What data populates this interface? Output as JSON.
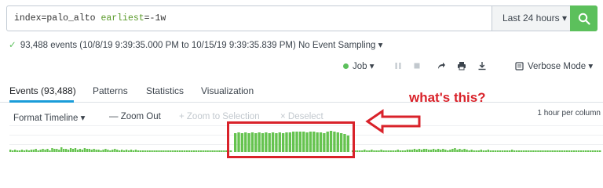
{
  "search": {
    "query_index": "index=palo_alto",
    "query_kw": "earliest",
    "query_val": "=-1w",
    "time_range": "Last 24 hours",
    "time_range_caret": "▾"
  },
  "status": {
    "check": "✓",
    "summary": "93,488 events (10/8/19 9:39:35.000 PM to 10/15/19 9:39:35.839 PM)",
    "sampling": "No Event Sampling ▾"
  },
  "toolbar": {
    "job": "Job ▾",
    "mode": "Verbose Mode ▾"
  },
  "tabs": [
    {
      "label": "Events (93,488)"
    },
    {
      "label": "Patterns"
    },
    {
      "label": "Statistics"
    },
    {
      "label": "Visualization"
    }
  ],
  "timeline": {
    "format": "Format Timeline ▾",
    "zoom_out": "— Zoom Out",
    "zoom_selection": "+ Zoom to Selection",
    "deselect": "× Deselect",
    "per_column": "1 hour per column",
    "bar_color": "#65c34f",
    "counts": [
      3,
      2,
      3,
      2,
      2,
      3,
      2,
      3,
      2,
      3,
      3,
      4,
      2,
      3,
      4,
      3,
      4,
      2,
      5,
      4,
      4,
      3,
      6,
      4,
      4,
      3,
      5,
      4,
      5,
      3,
      4,
      3,
      5,
      4,
      4,
      3,
      4,
      3,
      3,
      2,
      3,
      4,
      3,
      2,
      3,
      4,
      3,
      2,
      3,
      2,
      3,
      2,
      3,
      2,
      3,
      2,
      2,
      2,
      2,
      2,
      2,
      2,
      2,
      2,
      2,
      2,
      2,
      2,
      2,
      2,
      2,
      2,
      2,
      2,
      2,
      2,
      2,
      2,
      2,
      2,
      2,
      2,
      2,
      2,
      2,
      2,
      2,
      2,
      2,
      2,
      2,
      2,
      2,
      2,
      2,
      2,
      2,
      2,
      2,
      2,
      2,
      2,
      2,
      2,
      2,
      2,
      2,
      2,
      2,
      2,
      2,
      2,
      2,
      2,
      2,
      2,
      2,
      2,
      2,
      2,
      2,
      2,
      2,
      2,
      2,
      2,
      2,
      2,
      2,
      2,
      2,
      2,
      2,
      2,
      2,
      2,
      2,
      2,
      2,
      2,
      2,
      2,
      2,
      2,
      2,
      2,
      2,
      2,
      2,
      2,
      2,
      2,
      2,
      2,
      2,
      2,
      2,
      2,
      2,
      2,
      2,
      2,
      2,
      2,
      2,
      2,
      2,
      2,
      2,
      2,
      2,
      2,
      2,
      2,
      2,
      2,
      2,
      2,
      2,
      2,
      2,
      2,
      2,
      2,
      2,
      2,
      2,
      2,
      2,
      2,
      2,
      2,
      2,
      2,
      2,
      2,
      2,
      2,
      2,
      2,
      2,
      2,
      2,
      2,
      2,
      2,
      2,
      2,
      2,
      2,
      2,
      2,
      2,
      2,
      2,
      2,
      2,
      2,
      2,
      2,
      2,
      2,
      2,
      2,
      2,
      2,
      2,
      2,
      2,
      2,
      2,
      2,
      2,
      2,
      2,
      2,
      2,
      2,
      2,
      2,
      2,
      2,
      2,
      2,
      2,
      2,
      2,
      2,
      2,
      2,
      2,
      2,
      2,
      2,
      2,
      2,
      2,
      2,
      2,
      2,
      2,
      2,
      2,
      2,
      2,
      2,
      2,
      2,
      2,
      2,
      2,
      2,
      2,
      2,
      2,
      2,
      2,
      2,
      2,
      2,
      2,
      2,
      2,
      2,
      2,
      2,
      2,
      2,
      2,
      2,
      2,
      2,
      2,
      2,
      2,
      2,
      2,
      2,
      2,
      2,
      2,
      2,
      2
    ],
    "spike": [
      24,
      25,
      24,
      25,
      24,
      25,
      24,
      25,
      24,
      25,
      24,
      25,
      24,
      25,
      24,
      25,
      25,
      26,
      26,
      26,
      26,
      25,
      26,
      26,
      25,
      25,
      24,
      26,
      27,
      26,
      25,
      24,
      23,
      21
    ],
    "tail": [
      2,
      2,
      2,
      2,
      2,
      3,
      2,
      2,
      3,
      2,
      2,
      2,
      3,
      2,
      2,
      2,
      2,
      2,
      2,
      3,
      2,
      2,
      2,
      3,
      3,
      3,
      4,
      3,
      4,
      3,
      4,
      4,
      3,
      3,
      4,
      3,
      4,
      3,
      4,
      3,
      2,
      3,
      4,
      5,
      3,
      4,
      3,
      4,
      3,
      2,
      3,
      2,
      2,
      2,
      3,
      2,
      2,
      3,
      2,
      2,
      2,
      2,
      2,
      2,
      2,
      2,
      2,
      3,
      2,
      2,
      2,
      2,
      2,
      2,
      2,
      2,
      2,
      2,
      2,
      2,
      2,
      2,
      2,
      2,
      2,
      2,
      2,
      2,
      2,
      2,
      2,
      2,
      2,
      2,
      2,
      2,
      2,
      2,
      2,
      2,
      2,
      2,
      2,
      2,
      2
    ]
  },
  "annotation": {
    "text": "what's this?",
    "color": "#d9222a"
  },
  "colors": {
    "accent": "#1a9cd9",
    "go_button": "#5cc05c"
  }
}
